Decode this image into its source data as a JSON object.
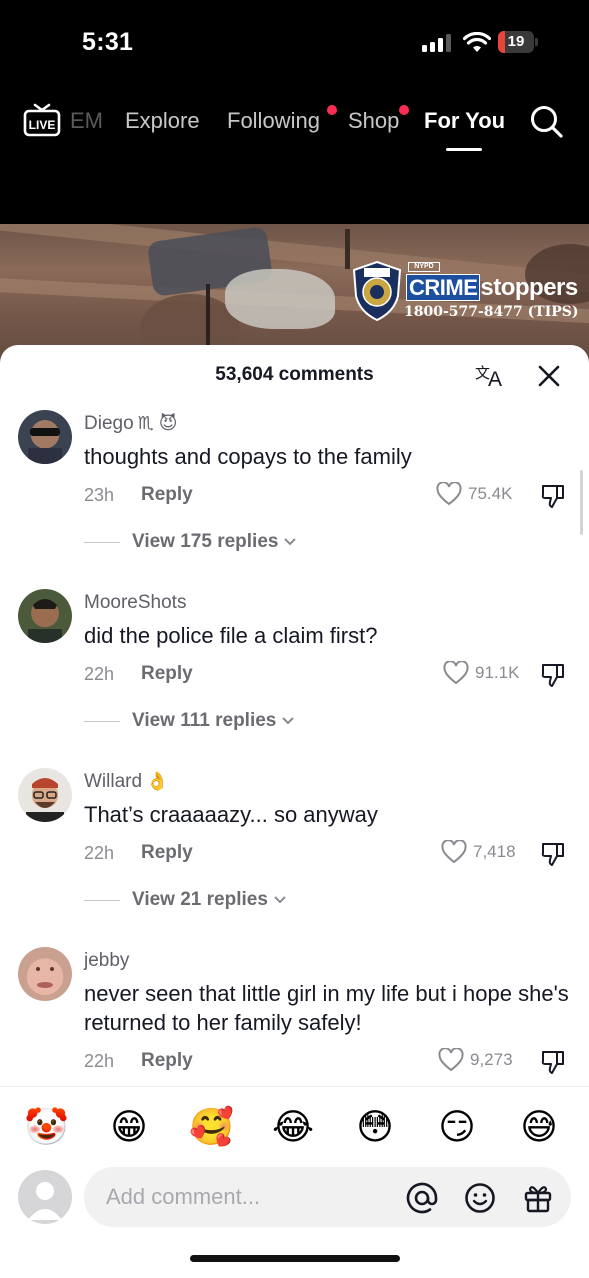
{
  "status_bar": {
    "time": "5:31",
    "battery": "19",
    "battery_level": 0.19,
    "battery_color": "#e8463b"
  },
  "top_nav": {
    "live_label": "LIVE",
    "tabs": [
      {
        "label": "EM",
        "state": "faded"
      },
      {
        "label": "Explore",
        "state": "normal"
      },
      {
        "label": "Following",
        "state": "normal",
        "dot": true
      },
      {
        "label": "Shop",
        "state": "normal",
        "dot": true
      },
      {
        "label": "For You",
        "state": "active"
      }
    ],
    "search_icon": "search-icon",
    "dot_color": "#fe2c55"
  },
  "video": {
    "nypd_label": "NYPD",
    "crime_label": "CRIME",
    "stoppers_label": "stoppers",
    "tips_line": "1800-577-8477 (TIPS)"
  },
  "sheet": {
    "comment_count": "53,604 comments",
    "translate_icon": "translate-icon",
    "close_icon": "close-icon"
  },
  "comments": [
    {
      "username": "Diego",
      "username_emoji": "♏ 😈",
      "text": "thoughts and copays to the family",
      "time": "23h",
      "reply_label": "Reply",
      "likes": "75.4K",
      "view_replies": "View 175 replies"
    },
    {
      "username": "MooreShots",
      "username_emoji": "",
      "text": "did the police file a claim first?",
      "time": "22h",
      "reply_label": "Reply",
      "likes": "91.1K",
      "view_replies": "View 111 replies"
    },
    {
      "username": "Willard",
      "username_emoji": "👌",
      "text": "That’s craaaaazy... so anyway",
      "time": "22h",
      "reply_label": "Reply",
      "likes": "7,418",
      "view_replies": "View 21 replies"
    },
    {
      "username": "jebby",
      "username_emoji": "",
      "text": "never seen that little girl in my life but i hope she's returned to her family safely!",
      "time": "22h",
      "reply_label": "Reply",
      "likes": "9,273"
    }
  ],
  "quick_emojis": [
    "🤡",
    "😁",
    "🥰",
    "😂",
    "😳",
    "😏",
    "😅"
  ],
  "composer": {
    "placeholder": "Add comment...",
    "icons": [
      "at-icon",
      "emoji-icon",
      "gift-icon"
    ]
  }
}
